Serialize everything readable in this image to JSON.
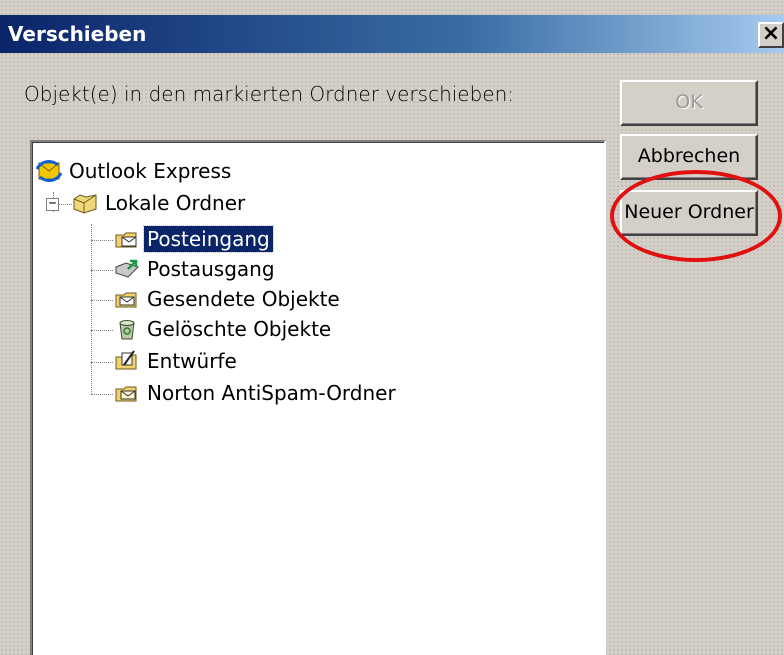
{
  "window": {
    "title": "Verschieben",
    "close_glyph": "×"
  },
  "instruction": "Objekt(e) in den markierten Ordner verschieben:",
  "buttons": {
    "ok": "OK",
    "cancel": "Abbrechen",
    "new_folder": "Neuer Ordner"
  },
  "tree": {
    "root": {
      "label": "Outlook Express",
      "icon": "outlook-express-icon"
    },
    "local": {
      "label": "Lokale Ordner",
      "icon": "local-folders-icon",
      "expander": "−"
    },
    "folders": [
      {
        "label": "Posteingang",
        "icon": "inbox-icon",
        "selected": true
      },
      {
        "label": "Postausgang",
        "icon": "outbox-icon"
      },
      {
        "label": "Gesendete Objekte",
        "icon": "sent-items-icon"
      },
      {
        "label": "Gelöschte Objekte",
        "icon": "deleted-items-icon"
      },
      {
        "label": "Entwürfe",
        "icon": "drafts-icon"
      },
      {
        "label": "Norton AntiSpam-Ordner",
        "icon": "antispam-folder-icon"
      }
    ]
  },
  "colors": {
    "titlebar_start": "#0a246a",
    "titlebar_end": "#a6caf0",
    "selection": "#0a246a",
    "annotation": "#e01010"
  }
}
